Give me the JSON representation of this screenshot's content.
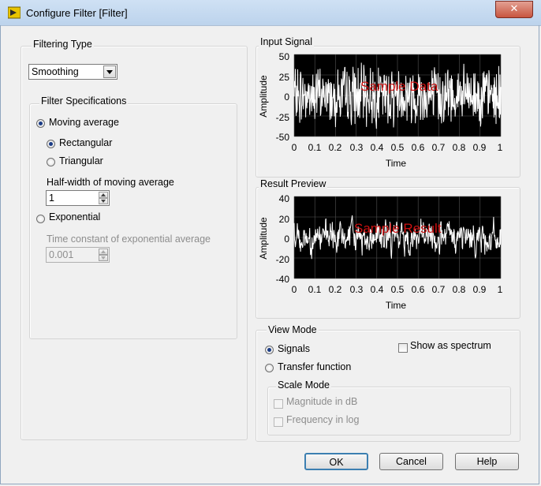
{
  "window": {
    "title": "Configure Filter [Filter]",
    "close_glyph": "✕",
    "icon": "labview-icon"
  },
  "filtering_type": {
    "label": "Filtering Type",
    "selected": "Smoothing"
  },
  "filter_specs": {
    "label": "Filter Specifications",
    "moving_average": "Moving average",
    "rectangular": "Rectangular",
    "triangular": "Triangular",
    "half_width_label": "Half-width of moving average",
    "half_width_value": "1",
    "exponential": "Exponential",
    "time_constant_label": "Time constant of exponential average",
    "time_constant_value": "0.001"
  },
  "input_signal": {
    "title": "Input Signal",
    "xlabel": "Time",
    "ylabel": "Amplitude",
    "watermark": "Sample Data",
    "yticks": [
      "50",
      "25",
      "0",
      "-25",
      "-50"
    ],
    "xticks": [
      "0",
      "0.1",
      "0.2",
      "0.3",
      "0.4",
      "0.5",
      "0.6",
      "0.7",
      "0.8",
      "0.9",
      "1"
    ]
  },
  "result_preview": {
    "title": "Result Preview",
    "xlabel": "Time",
    "ylabel": "Amplitude",
    "watermark": "Sample Result",
    "yticks": [
      "40",
      "20",
      "0",
      "-20",
      "-40"
    ],
    "xticks": [
      "0",
      "0.1",
      "0.2",
      "0.3",
      "0.4",
      "0.5",
      "0.6",
      "0.7",
      "0.8",
      "0.9",
      "1"
    ]
  },
  "chart_data": [
    {
      "type": "line",
      "title": "Input Signal",
      "xlabel": "Time",
      "ylabel": "Amplitude",
      "xlim": [
        0,
        1
      ],
      "ylim": [
        -50,
        50
      ],
      "grid": true,
      "series_color": "#ffffff",
      "background": "#000000",
      "annotation": "Sample Data"
    },
    {
      "type": "line",
      "title": "Result Preview",
      "xlabel": "Time",
      "ylabel": "Amplitude",
      "xlim": [
        0,
        1
      ],
      "ylim": [
        -40,
        40
      ],
      "grid": true,
      "series_color": "#ffffff",
      "background": "#000000",
      "annotation": "Sample Result"
    }
  ],
  "view_mode": {
    "label": "View Mode",
    "signals": "Signals",
    "transfer": "Transfer function",
    "show_spectrum": "Show as spectrum",
    "scale_mode": "Scale Mode",
    "mag_db": "Magnitude in dB",
    "freq_log": "Frequency in log"
  },
  "buttons": {
    "ok": "OK",
    "cancel": "Cancel",
    "help": "Help"
  },
  "colors": {
    "watermark": "#cc1111",
    "plot_bg": "#000000",
    "trace": "#ffffff"
  }
}
